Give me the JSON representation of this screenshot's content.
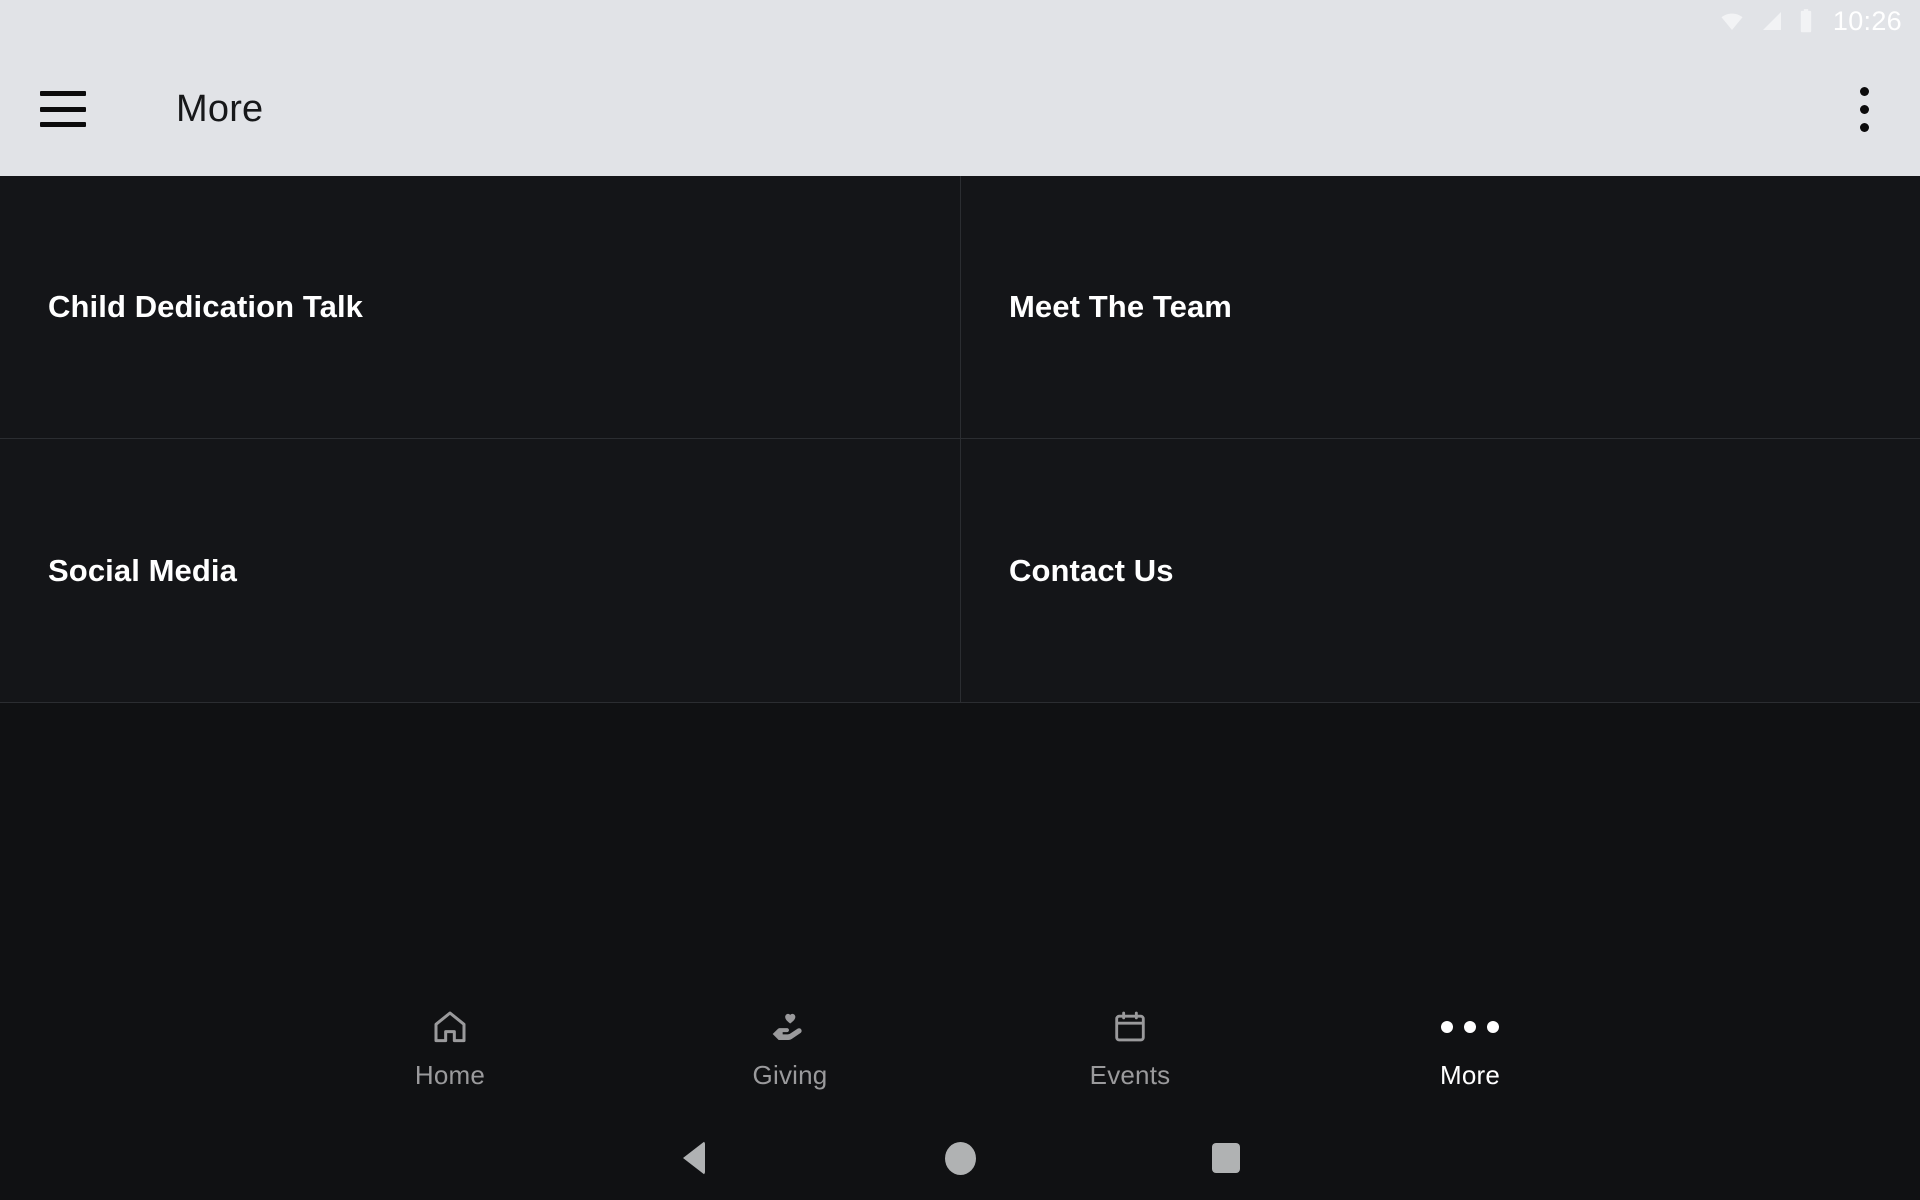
{
  "status_bar": {
    "clock": "10:26",
    "icons": [
      "wifi-icon",
      "cellular-signal-icon",
      "battery-icon"
    ],
    "background": "#e1e3e7"
  },
  "app_bar": {
    "menu_icon": "hamburger-menu-icon",
    "title": "More",
    "overflow_icon": "overflow-menu-icon",
    "background": "#e1e3e7",
    "title_color": "#17181a"
  },
  "main": {
    "tiles": [
      {
        "label": "Child Dedication Talk"
      },
      {
        "label": "Meet The Team"
      },
      {
        "label": "Social Media"
      },
      {
        "label": "Contact Us"
      }
    ],
    "tile_background": "#141518",
    "divider_color": "#2b2d31",
    "page_background": "#101113"
  },
  "bottom_nav": {
    "items": [
      {
        "label": "Home",
        "icon": "home-icon",
        "active": false
      },
      {
        "label": "Giving",
        "icon": "hand-heart-icon",
        "active": false
      },
      {
        "label": "Events",
        "icon": "calendar-icon",
        "active": false
      },
      {
        "label": "More",
        "icon": "more-dots-icon",
        "active": true
      }
    ],
    "inactive_color": "#9a9a9c",
    "active_color": "#ffffff"
  },
  "android_nav": {
    "buttons": [
      {
        "name": "back-button",
        "icon": "back-triangle-icon"
      },
      {
        "name": "home-button",
        "icon": "home-circle-icon"
      },
      {
        "name": "recents-button",
        "icon": "recents-square-icon"
      }
    ],
    "color": "#b0b2b3"
  }
}
